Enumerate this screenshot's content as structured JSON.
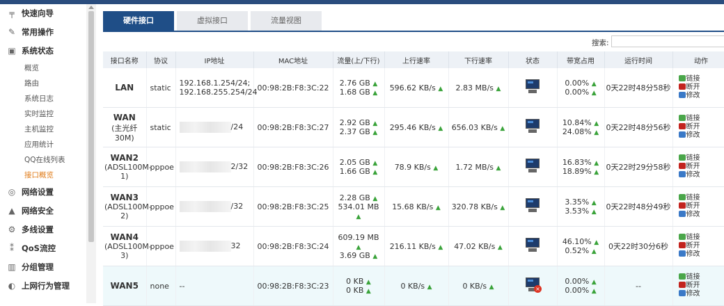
{
  "sidebar": {
    "items": [
      {
        "label": "快速向导",
        "icon": "pin-icon"
      },
      {
        "label": "常用操作",
        "icon": "wrench-icon"
      },
      {
        "label": "系统状态",
        "icon": "monitor-icon"
      }
    ],
    "subitems": [
      "概览",
      "路由",
      "系统日志",
      "实时监控",
      "主机监控",
      "应用统计",
      "QQ在线列表",
      "接口概览"
    ],
    "items2": [
      {
        "label": "网络设置",
        "icon": "globe-icon"
      },
      {
        "label": "网络安全",
        "icon": "shield-icon"
      },
      {
        "label": "多线设置",
        "icon": "gear-icon"
      },
      {
        "label": "QoS流控",
        "icon": "qos-icon"
      },
      {
        "label": "分组管理",
        "icon": "group-icon"
      },
      {
        "label": "上网行为管理",
        "icon": "behavior-icon"
      }
    ]
  },
  "tabs": [
    "硬件接口",
    "虚拟接口",
    "流量视图"
  ],
  "search": {
    "label": "搜索:"
  },
  "columns": [
    "接口名称",
    "协议",
    "IP地址",
    "MAC地址",
    "流量(上/下行)",
    "上行速率",
    "下行速率",
    "状态",
    "带宽占用",
    "运行时间",
    "动作"
  ],
  "rows": [
    {
      "name": "LAN",
      "sub": "",
      "proto": "static",
      "ip1": "192.168.1.254/24;",
      "ip2": "192.168.255.254/24",
      "masked": false,
      "mac": "00:98:2B:F8:3C:22",
      "t1": "2.76 GB",
      "t2": "1.68 GB",
      "up": "596.62 KB/s",
      "down": "2.83 MB/s",
      "bw1": "0.00%",
      "bw2": "0.00%",
      "time": "0天22时48分58秒",
      "offline": false
    },
    {
      "name": "WAN",
      "sub": "(主光纤30M)",
      "proto": "static",
      "ip1": "/24",
      "ip2": "",
      "masked": true,
      "mac": "00:98:2B:F8:3C:27",
      "t1": "2.92 GB",
      "t2": "2.37 GB",
      "up": "295.46 KB/s",
      "down": "656.03 KB/s",
      "bw1": "10.84%",
      "bw2": "24.08%",
      "time": "0天22时48分56秒",
      "offline": false
    },
    {
      "name": "WAN2",
      "sub": "(ADSL100M-1)",
      "proto": "pppoe",
      "ip1": "2/32",
      "ip2": "",
      "masked": true,
      "mac": "00:98:2B:F8:3C:26",
      "t1": "2.05 GB",
      "t2": "1.66 GB",
      "up": "78.9 KB/s",
      "down": "1.72 MB/s",
      "bw1": "16.83%",
      "bw2": "18.89%",
      "time": "0天22时29分58秒",
      "offline": false
    },
    {
      "name": "WAN3",
      "sub": "(ADSL100M-2)",
      "proto": "pppoe",
      "ip1": "/32",
      "ip2": "",
      "masked": true,
      "mac": "00:98:2B:F8:3C:25",
      "t1": "2.28 GB",
      "t2": "534.01 MB",
      "up": "15.68 KB/s",
      "down": "320.78 KB/s",
      "bw1": "3.35%",
      "bw2": "3.53%",
      "time": "0天22时48分49秒",
      "offline": false
    },
    {
      "name": "WAN4",
      "sub": "(ADSL100M-3)",
      "proto": "pppoe",
      "ip1": "32",
      "ip2": "",
      "masked": true,
      "mac": "00:98:2B:F8:3C:24",
      "t1": "609.19 MB",
      "t2": "3.69 GB",
      "up": "216.11 KB/s",
      "down": "47.02 KB/s",
      "bw1": "46.10%",
      "bw2": "0.52%",
      "time": "0天22时30分6秒",
      "offline": false
    },
    {
      "name": "WAN5",
      "sub": "",
      "proto": "none",
      "ip1": "--",
      "ip2": "",
      "masked": false,
      "mac": "00:98:2B:F8:3C:23",
      "t1": "0 KB",
      "t2": "0 KB",
      "up": "0 KB/s",
      "down": "0 KB/s",
      "bw1": "0.00%",
      "bw2": "0.00%",
      "time": "--",
      "offline": true
    }
  ],
  "actions": [
    "链接",
    "断开",
    "修改"
  ],
  "colors": {
    "accent": "#1f4e87",
    "active_sub": "#e07b17",
    "up_arrow": "#3aa33a"
  }
}
